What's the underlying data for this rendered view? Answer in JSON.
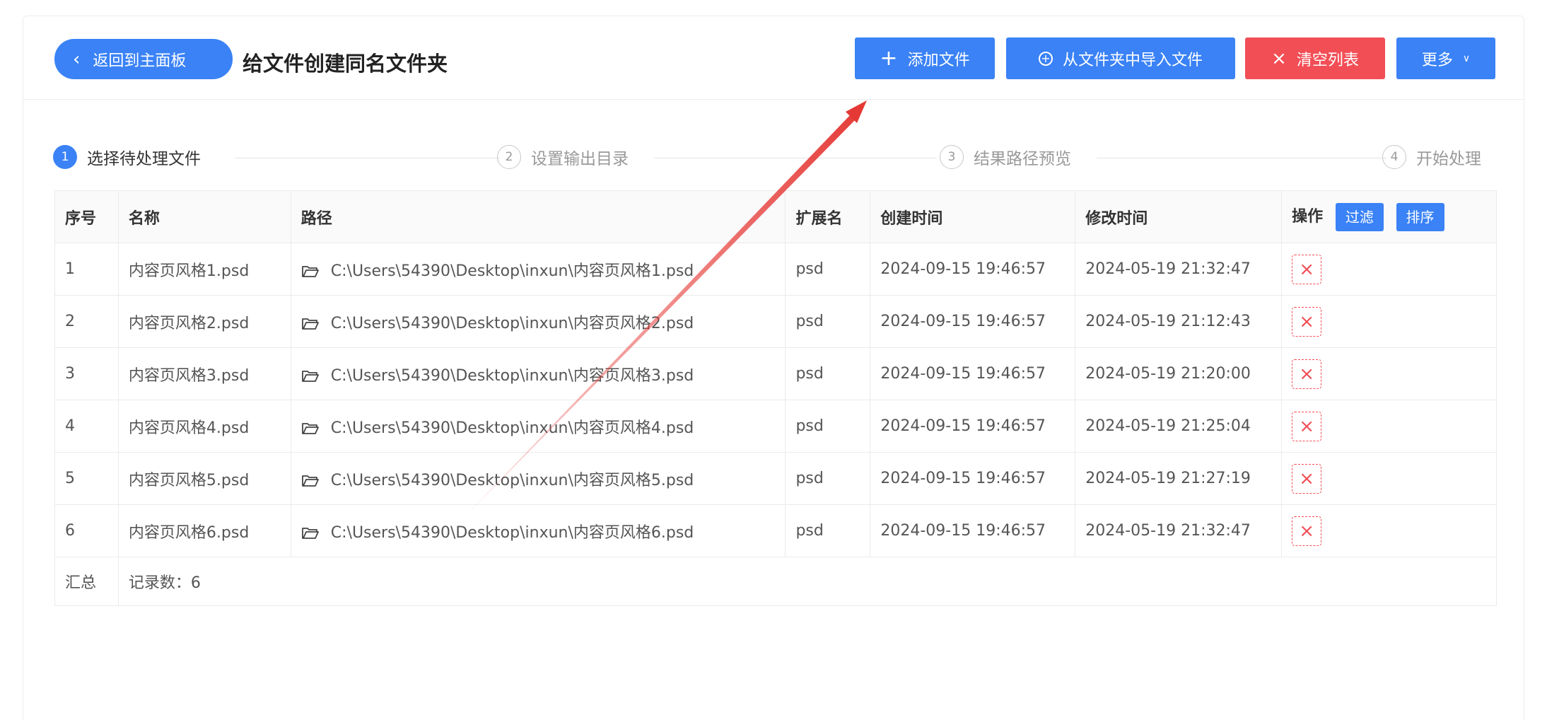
{
  "header": {
    "back_label": "返回到主面板",
    "title": "给文件创建同名文件夹",
    "add_label": "添加文件",
    "import_label": "从文件夹中导入文件",
    "clear_label": "清空列表",
    "more_label": "更多"
  },
  "steps": [
    {
      "num": "1",
      "label": "选择待处理文件"
    },
    {
      "num": "2",
      "label": "设置输出目录"
    },
    {
      "num": "3",
      "label": "结果路径预览"
    },
    {
      "num": "4",
      "label": "开始处理"
    }
  ],
  "table": {
    "headers": {
      "index": "序号",
      "name": "名称",
      "path": "路径",
      "ext": "扩展名",
      "created": "创建时间",
      "modified": "修改时间",
      "ops": "操作"
    },
    "filter_label": "过滤",
    "sort_label": "排序",
    "rows": [
      {
        "index": "1",
        "name": "内容页风格1.psd",
        "path": "C:\\Users\\54390\\Desktop\\inxun\\内容页风格1.psd",
        "ext": "psd",
        "created": "2024-09-15 19:46:57",
        "modified": "2024-05-19 21:32:47"
      },
      {
        "index": "2",
        "name": "内容页风格2.psd",
        "path": "C:\\Users\\54390\\Desktop\\inxun\\内容页风格2.psd",
        "ext": "psd",
        "created": "2024-09-15 19:46:57",
        "modified": "2024-05-19 21:12:43"
      },
      {
        "index": "3",
        "name": "内容页风格3.psd",
        "path": "C:\\Users\\54390\\Desktop\\inxun\\内容页风格3.psd",
        "ext": "psd",
        "created": "2024-09-15 19:46:57",
        "modified": "2024-05-19 21:20:00"
      },
      {
        "index": "4",
        "name": "内容页风格4.psd",
        "path": "C:\\Users\\54390\\Desktop\\inxun\\内容页风格4.psd",
        "ext": "psd",
        "created": "2024-09-15 19:46:57",
        "modified": "2024-05-19 21:25:04"
      },
      {
        "index": "5",
        "name": "内容页风格5.psd",
        "path": "C:\\Users\\54390\\Desktop\\inxun\\内容页风格5.psd",
        "ext": "psd",
        "created": "2024-09-15 19:46:57",
        "modified": "2024-05-19 21:27:19"
      },
      {
        "index": "6",
        "name": "内容页风格6.psd",
        "path": "C:\\Users\\54390\\Desktop\\inxun\\内容页风格6.psd",
        "ext": "psd",
        "created": "2024-09-15 19:46:57",
        "modified": "2024-05-19 21:32:47"
      }
    ],
    "summary_label": "汇总",
    "summary_count": "记录数：6"
  },
  "icons": {
    "back": "chevron-left-icon",
    "add": "plus-icon",
    "import": "circle-plus-icon",
    "clear": "close-icon",
    "more": "chevron-down-icon",
    "folder": "folder-icon",
    "delete": "close-icon"
  },
  "colors": {
    "primary": "#3a82f6",
    "danger": "#f24e56",
    "annotation_arrow": "#e53935"
  }
}
